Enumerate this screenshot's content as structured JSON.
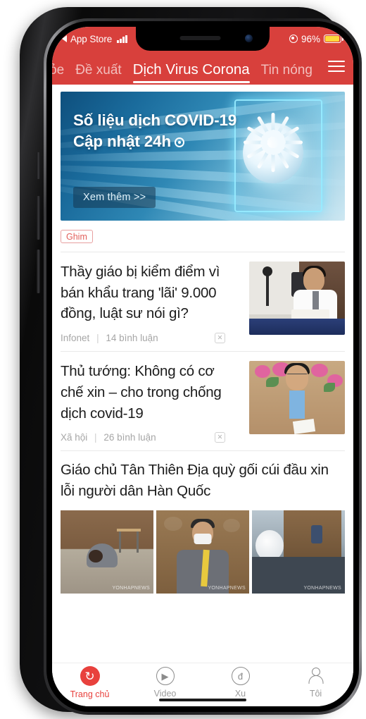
{
  "status_bar": {
    "back_label": "App Store",
    "signal_icon": "signal-bars-icon",
    "location_icon": "location-services-icon",
    "battery_percent": "96%",
    "battery_icon": "battery-low-power-icon",
    "battery_color": "#fdd93c"
  },
  "header": {
    "background_color": "#d8403c",
    "tabs": [
      {
        "label": "khỏe",
        "active": false,
        "clipped": true
      },
      {
        "label": "Đề xuất",
        "active": false
      },
      {
        "label": "Dịch Virus Corona",
        "active": true
      },
      {
        "label": "Tin nóng",
        "active": false
      }
    ],
    "menu_icon": "hamburger-menu-icon"
  },
  "banner": {
    "line1": "Số liệu dịch COVID-19",
    "line2": "Cập nhật 24h",
    "update_icon": "target-refresh-icon",
    "cta_label": "Xem thêm >>",
    "image_alt": "covid-virus-dna-graphic"
  },
  "pinned_badge": {
    "label": "Ghim",
    "border_color": "#e8a0a0",
    "text_color": "#e2605c"
  },
  "articles": [
    {
      "title": "Thầy giáo bị kiểm điểm vì bán khẩu trang 'lãi' 9.000 đồng, luật sư nói gì?",
      "source": "Infonet",
      "comments": "14 bình luận",
      "separator": "|",
      "dismiss_icon": "close-x-icon",
      "thumbnail_alt": "man-in-white-shirt-at-desk"
    },
    {
      "title": "Thủ tướng: Không có cơ chế xin – cho trong chống dịch covid-19",
      "source": "Xã hội",
      "comments": "26 bình luận",
      "separator": "|",
      "dismiss_icon": "close-x-icon",
      "thumbnail_alt": "official-in-dark-suit-with-flowers"
    }
  ],
  "gallery_article": {
    "title": "Giáo chủ Tân Thiên Địa quỳ gối cúi đầu xin lỗi người dân Hàn Quốc",
    "watermark": "YONHAPNEWS",
    "images": [
      {
        "alt": "man-bowing-on-floor"
      },
      {
        "alt": "man-with-mask-speaking"
      },
      {
        "alt": "press-crowd-with-cameras"
      }
    ]
  },
  "tabbar": {
    "items": [
      {
        "label": "Trang chủ",
        "icon": "refresh-home-icon",
        "glyph": "↻",
        "active": true
      },
      {
        "label": "Video",
        "icon": "play-circle-icon",
        "glyph": "▶",
        "active": false
      },
      {
        "label": "Xu",
        "icon": "coin-dong-icon",
        "glyph": "đ",
        "active": false
      },
      {
        "label": "Tôi",
        "icon": "person-profile-icon",
        "glyph": "",
        "active": false
      }
    ],
    "active_color": "#e8413d"
  }
}
